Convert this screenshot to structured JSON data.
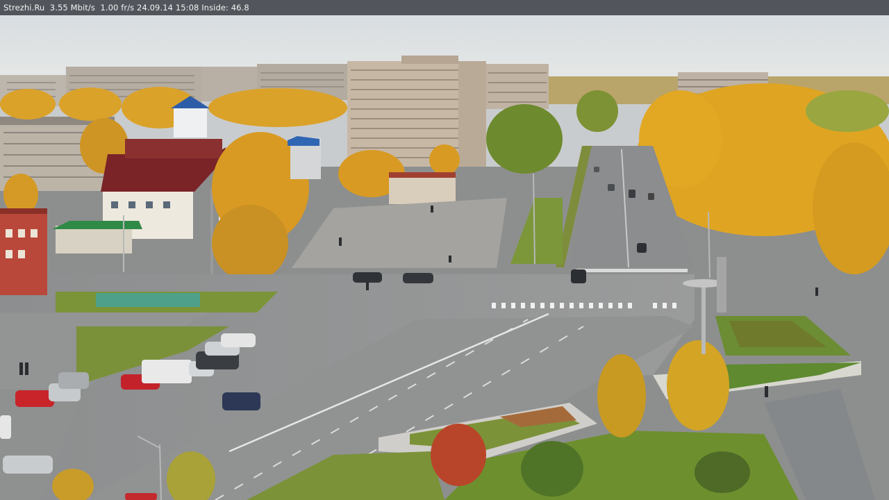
{
  "overlay": {
    "text": "Strezhi.Ru  3.55 Mbit/s  1.00 fr/s 24.09.14 15:08 Inside: 46.8"
  },
  "scene": {
    "kind": "webcam-view",
    "colors": {
      "sky": "#dfe3e6",
      "foliage_yellow": "#e0a020",
      "foliage_green": "#5f8a2e",
      "asphalt": "#8f9090",
      "grass": "#7f9a3c",
      "brick": "#b44a36"
    }
  }
}
